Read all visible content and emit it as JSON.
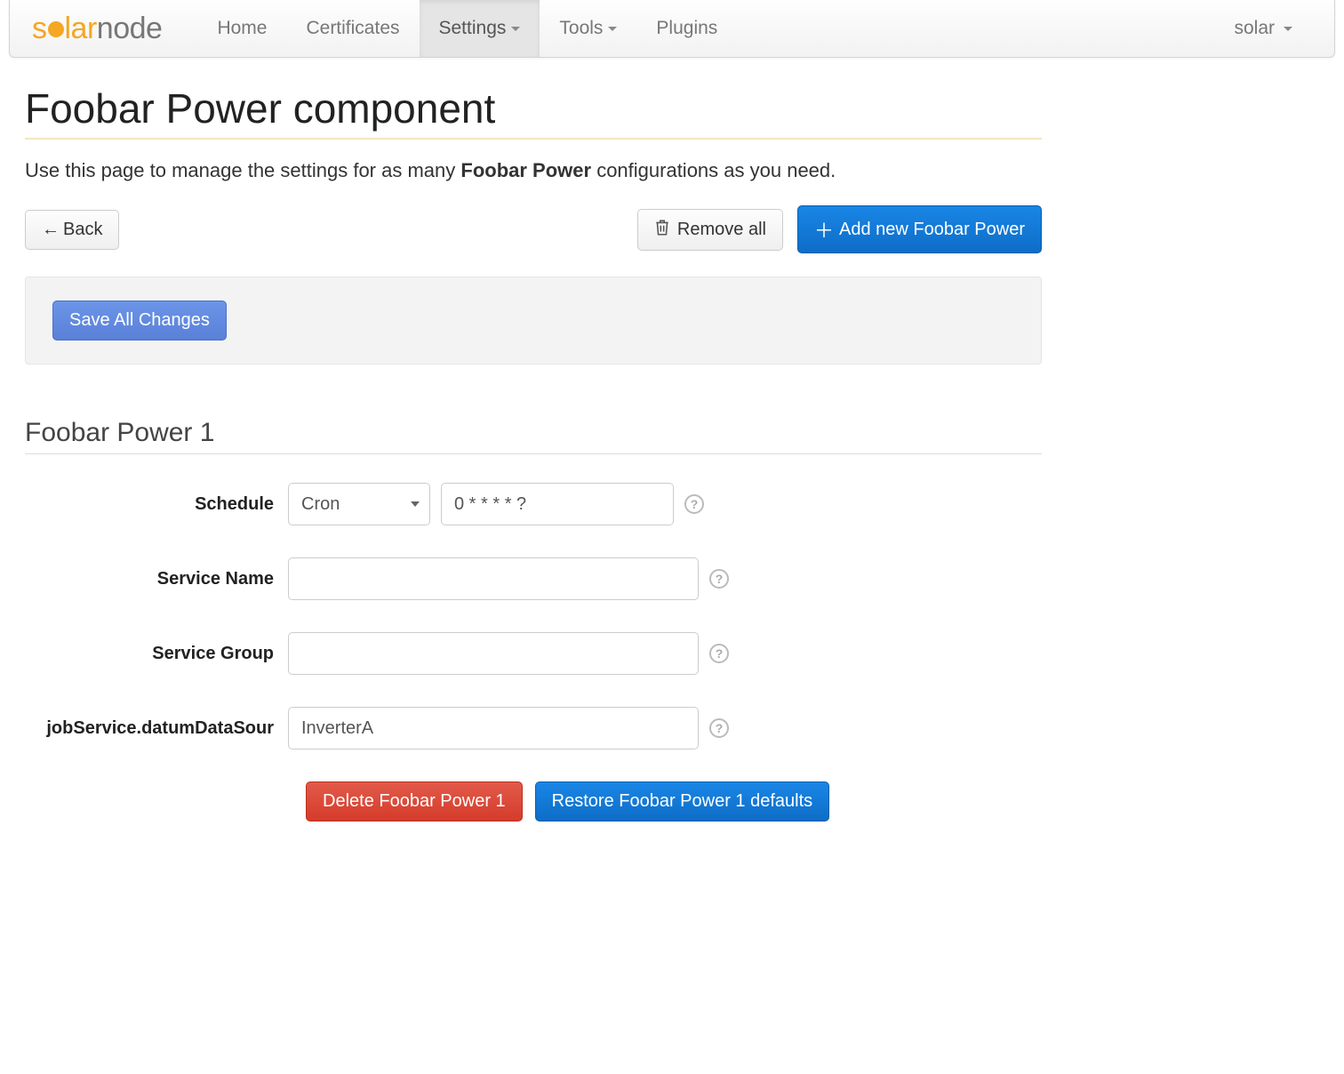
{
  "brand": {
    "part1": "s",
    "part2": "lar",
    "part3": "node"
  },
  "nav": {
    "home": "Home",
    "certificates": "Certificates",
    "settings": "Settings",
    "tools": "Tools",
    "plugins": "Plugins",
    "user": "solar"
  },
  "page": {
    "title": "Foobar Power component",
    "lead_pre": "Use this page to manage the settings for as many ",
    "lead_bold": "Foobar Power",
    "lead_post": " configurations as you need."
  },
  "actions": {
    "back": "Back",
    "remove_all": "Remove all",
    "add_new": "Add new Foobar Power",
    "save_all": "Save All Changes"
  },
  "instance": {
    "heading": "Foobar Power 1",
    "fields": {
      "schedule_label": "Schedule",
      "schedule_type": "Cron",
      "schedule_value": "0 * * * * ?",
      "service_name_label": "Service Name",
      "service_name_value": "",
      "service_group_label": "Service Group",
      "service_group_value": "",
      "datasource_label": "jobService.datumDataSour",
      "datasource_value": "InverterA"
    },
    "buttons": {
      "delete": "Delete Foobar Power 1",
      "restore": "Restore Foobar Power 1 defaults"
    }
  }
}
